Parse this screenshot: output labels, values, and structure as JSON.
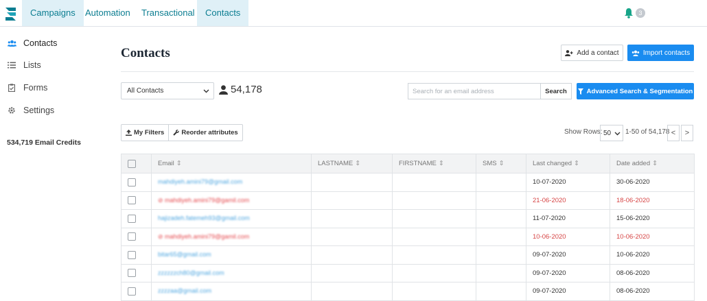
{
  "nav": {
    "tabs": [
      {
        "label": "Campaigns",
        "active": true
      },
      {
        "label": "Automation",
        "active": false
      },
      {
        "label": "Transactional",
        "active": false
      },
      {
        "label": "Contacts",
        "active": true
      }
    ],
    "notification_count": "3"
  },
  "sidebar": {
    "items": [
      {
        "label": "Contacts",
        "icon": "users-icon",
        "active": true
      },
      {
        "label": "Lists",
        "icon": "list-icon"
      },
      {
        "label": "Forms",
        "icon": "clipboard-icon"
      },
      {
        "label": "Settings",
        "icon": "gear-icon"
      }
    ],
    "credits": "534,719 Email Credits"
  },
  "header": {
    "title": "Contacts",
    "add_contact": "Add a contact",
    "import_contacts": "Import contacts"
  },
  "filters": {
    "list_select": "All Contacts",
    "contact_count": "54,178",
    "search_placeholder": "Search for an email address",
    "search_button": "Search",
    "advanced_search": "Advanced Search & Segmentation",
    "my_filters": "My Filters",
    "reorder": "Reorder attributes",
    "show_rows_label": "Show Rows:",
    "rows_per_page": "50",
    "range": "1-50 of 54,178",
    "prev": "<",
    "next": ">"
  },
  "table": {
    "columns": [
      "Email",
      "LASTNAME",
      "FIRSTNAME",
      "SMS",
      "Last changed",
      "Date added"
    ],
    "rows": [
      {
        "email": "mahdiyeh.amini79@gmail.com",
        "blacklisted": false,
        "last_changed": "10-07-2020",
        "date_added": "30-06-2020"
      },
      {
        "email": "mahdiyeh.amini79@gamil.com",
        "blacklisted": true,
        "last_changed": "21-06-2020",
        "date_added": "18-06-2020"
      },
      {
        "email": "hajizadeh.fatemeh93@gmail.com",
        "blacklisted": false,
        "last_changed": "11-07-2020",
        "date_added": "15-06-2020"
      },
      {
        "email": "mahdiyeh.amini79@gamil.com",
        "blacklisted": true,
        "last_changed": "10-06-2020",
        "date_added": "10-06-2020"
      },
      {
        "email": "bitar65@gmail.com",
        "blacklisted": false,
        "last_changed": "09-07-2020",
        "date_added": "10-06-2020"
      },
      {
        "email": "zzzzzzch80@gmail.com",
        "blacklisted": false,
        "last_changed": "09-07-2020",
        "date_added": "08-06-2020"
      },
      {
        "email": "zzzzaa@gmail.com",
        "blacklisted": false,
        "last_changed": "09-07-2020",
        "date_added": "08-06-2020"
      }
    ]
  },
  "colors": {
    "brand": "#0b7d91",
    "primary": "#1a8cf0",
    "blacklisted": "#d64545"
  }
}
